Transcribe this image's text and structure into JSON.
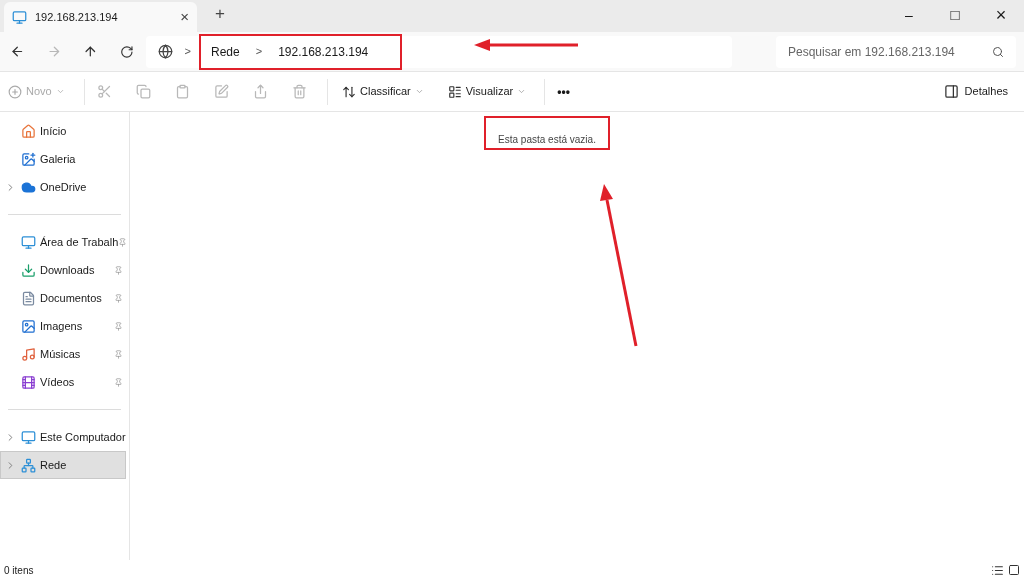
{
  "tab": {
    "title": "192.168.213.194",
    "close": "×",
    "new": "+"
  },
  "window_controls": {
    "minimize": "–",
    "maximize": "□",
    "close": "×"
  },
  "address": {
    "crumbs": [
      "Rede",
      "192.168.213.194"
    ],
    "separator": ">"
  },
  "search": {
    "placeholder": "Pesquisar em 192.168.213.194"
  },
  "toolbar": {
    "new": "Novo",
    "sort": "Classificar",
    "view": "Visualizar",
    "more": "•••",
    "details": "Detalhes"
  },
  "sidebar": {
    "groups": [
      [
        {
          "label": "Início",
          "expandable": false,
          "pinned": false,
          "selected": false
        },
        {
          "label": "Galeria",
          "expandable": false,
          "pinned": false,
          "selected": false
        },
        {
          "label": "OneDrive",
          "expandable": true,
          "pinned": false,
          "selected": false
        }
      ],
      [
        {
          "label": "Área de Trabalh",
          "expandable": false,
          "pinned": true,
          "selected": false
        },
        {
          "label": "Downloads",
          "expandable": false,
          "pinned": true,
          "selected": false
        },
        {
          "label": "Documentos",
          "expandable": false,
          "pinned": true,
          "selected": false
        },
        {
          "label": "Imagens",
          "expandable": false,
          "pinned": true,
          "selected": false
        },
        {
          "label": "Músicas",
          "expandable": false,
          "pinned": true,
          "selected": false
        },
        {
          "label": "Vídeos",
          "expandable": false,
          "pinned": true,
          "selected": false
        }
      ],
      [
        {
          "label": "Este Computador",
          "expandable": true,
          "pinned": false,
          "selected": false
        },
        {
          "label": "Rede",
          "expandable": true,
          "pinned": false,
          "selected": true
        }
      ]
    ]
  },
  "content": {
    "empty_message": "Esta pasta está vazia."
  },
  "status_bar": {
    "count": "0 itens"
  }
}
